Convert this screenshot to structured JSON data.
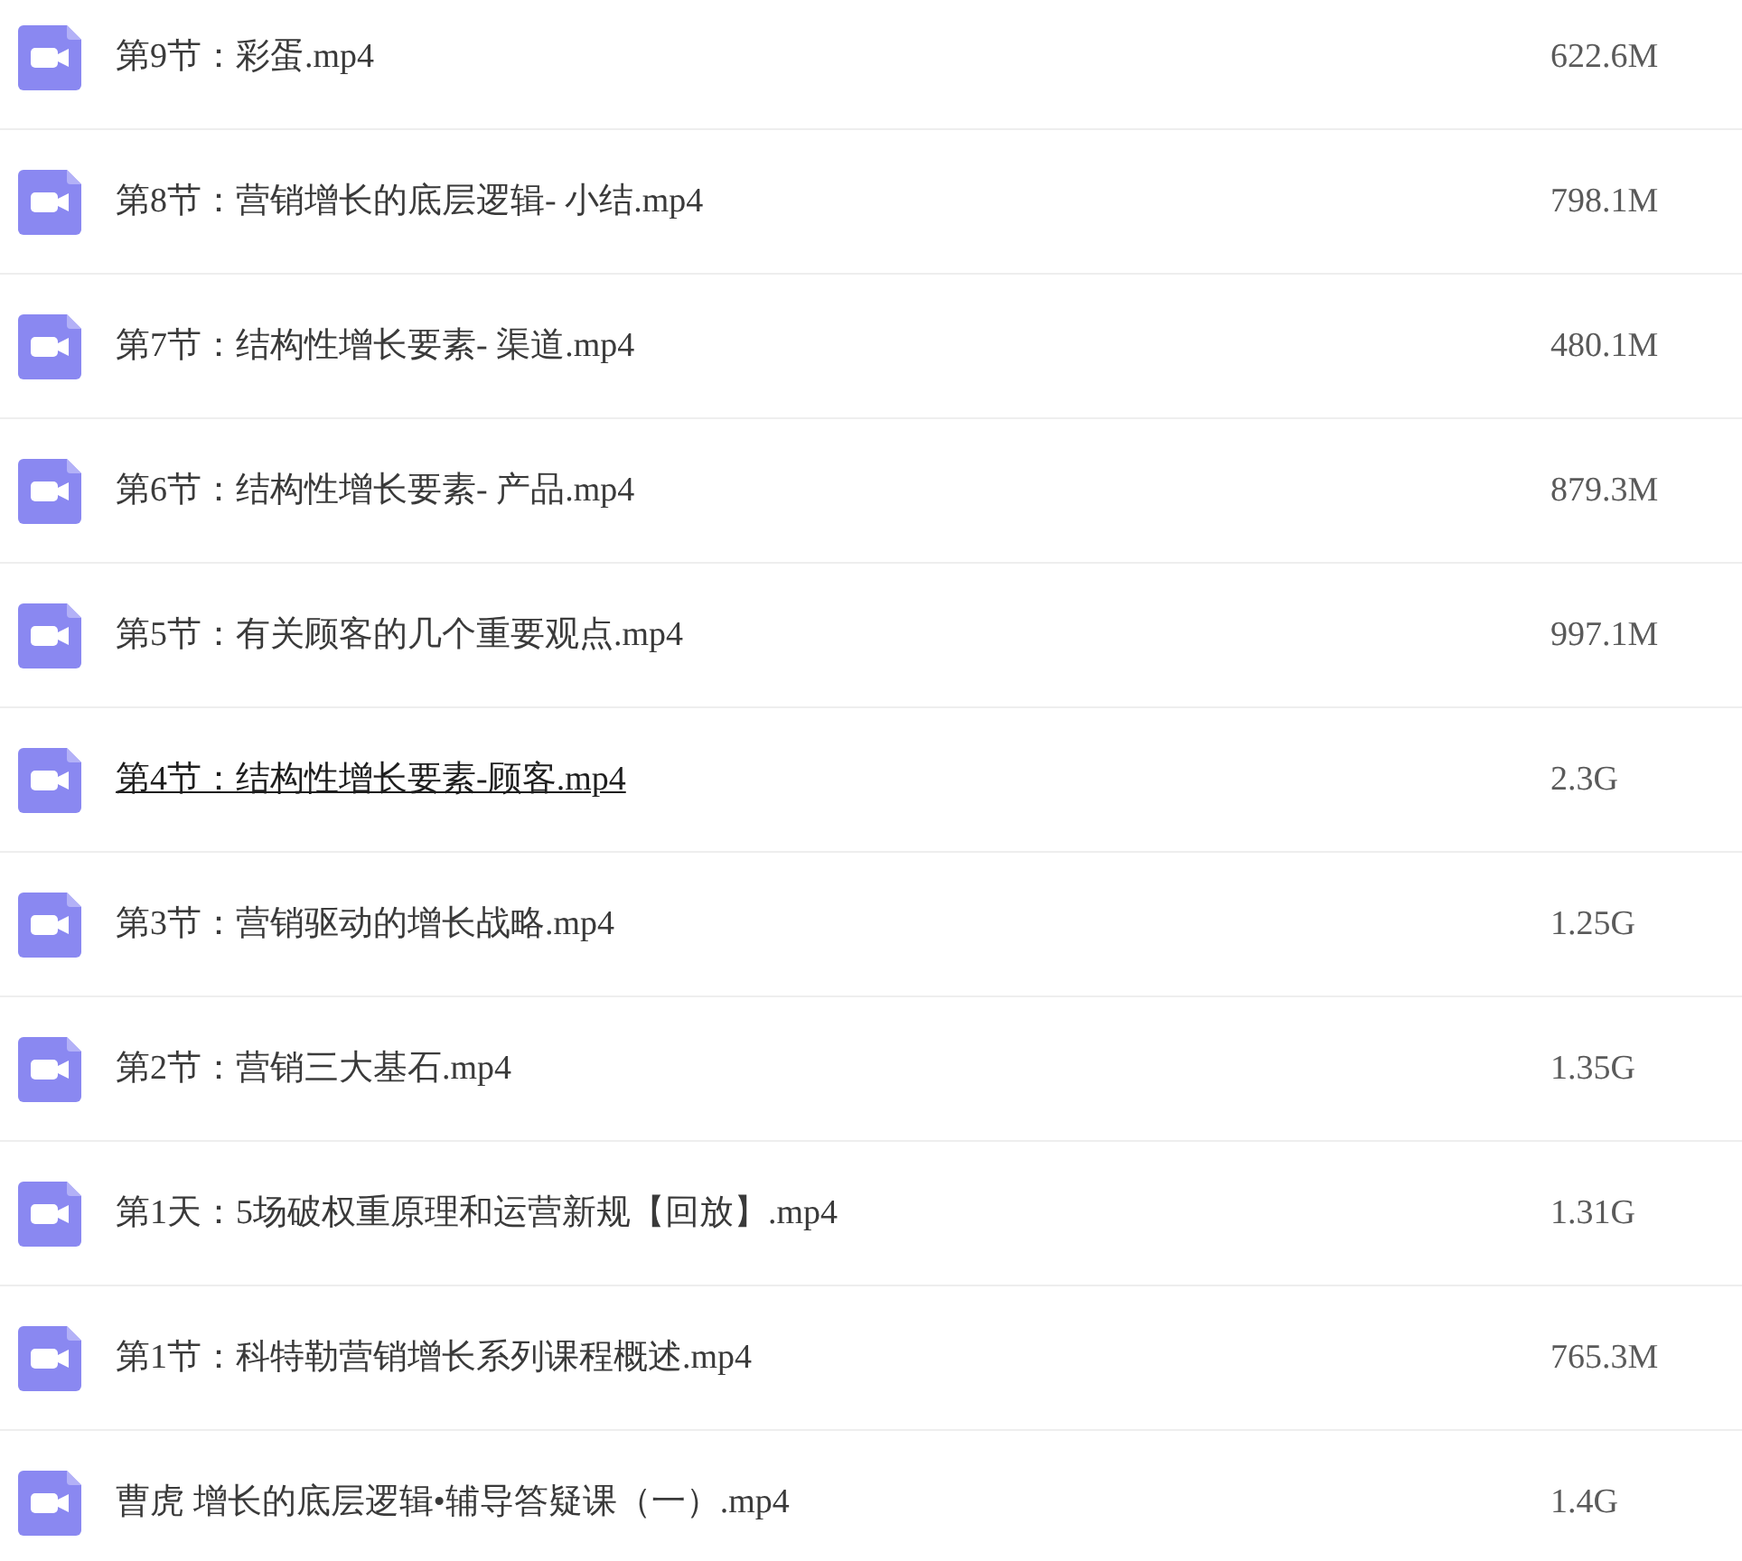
{
  "files": [
    {
      "name": "第9节：彩蛋.mp4",
      "size": "622.6M",
      "hovered": false
    },
    {
      "name": "第8节：营销增长的底层逻辑- 小结.mp4",
      "size": "798.1M",
      "hovered": false
    },
    {
      "name": "第7节：结构性增长要素- 渠道.mp4",
      "size": "480.1M",
      "hovered": false
    },
    {
      "name": "第6节：结构性增长要素- 产品.mp4",
      "size": "879.3M",
      "hovered": false
    },
    {
      "name": "第5节：有关顾客的几个重要观点.mp4",
      "size": "997.1M",
      "hovered": false
    },
    {
      "name": "第4节：结构性增长要素-顾客.mp4",
      "size": "2.3G",
      "hovered": true
    },
    {
      "name": "第3节：营销驱动的增长战略.mp4",
      "size": "1.25G",
      "hovered": false
    },
    {
      "name": "第2节：营销三大基石.mp4",
      "size": "1.35G",
      "hovered": false
    },
    {
      "name": "第1天：5场破权重原理和运营新规【回放】.mp4",
      "size": "1.31G",
      "hovered": false
    },
    {
      "name": "第1节：科特勒营销增长系列课程概述.mp4",
      "size": "765.3M",
      "hovered": false
    },
    {
      "name": "曹虎 增长的底层逻辑•辅导答疑课（一）.mp4",
      "size": "1.4G",
      "hovered": false
    }
  ]
}
